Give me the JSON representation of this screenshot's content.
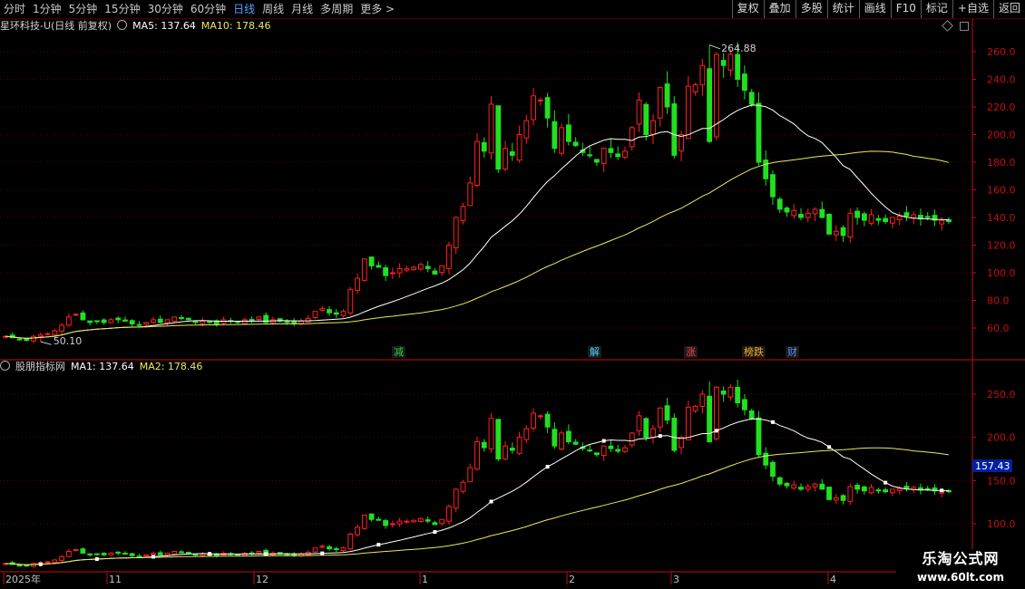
{
  "toolbar": {
    "periods": [
      "分时",
      "1分钟",
      "5分钟",
      "15分钟",
      "30分钟",
      "60分钟",
      "日线",
      "周线",
      "月线",
      "多周期",
      "更多 >"
    ],
    "active_period": "日线",
    "buttons": [
      "复权",
      "叠加",
      "多股",
      "统计",
      "画线",
      "F10",
      "标记",
      "+自选",
      "返回"
    ]
  },
  "main_title": {
    "stock": "星环科技-U(日线 前复权)",
    "ma5": "MA5: 137.64",
    "ma10": "MA10: 178.46"
  },
  "sub_title": {
    "name": "股朋指标网",
    "ma1": "MA1: 137.64",
    "ma2": "MA2: 178.46"
  },
  "annotations": {
    "high": "264.88",
    "low": "50.10",
    "last_value": "157.43"
  },
  "event_tags": [
    {
      "text": "减",
      "color": "#2ecc40"
    },
    {
      "text": "解",
      "color": "#4ad0ff"
    },
    {
      "text": "涨",
      "color": "#ff4040"
    },
    {
      "text": "榜跌",
      "color": "#ffb020"
    },
    {
      "text": "财",
      "color": "#5c8aff"
    }
  ],
  "watermark": {
    "line1": "乐淘公式网",
    "line2": "www.60lt.com"
  },
  "colors": {
    "up": "#ff2020",
    "down": "#20e020",
    "ma_short": "#ffffff",
    "ma_long": "#e8e860",
    "axis": "#c01010",
    "text": "#c0c0c0"
  },
  "chart_data": [
    {
      "type": "candlestick",
      "title": "星环科技-U(日线 前复权)",
      "ylim": [
        50,
        275
      ],
      "y_ticks": [
        60,
        80,
        100,
        120,
        140,
        160,
        180,
        200,
        220,
        240,
        260
      ],
      "x_ticks": [
        "2025年",
        "11",
        "12",
        "1",
        "2",
        "3",
        "4"
      ],
      "price_path": [
        54,
        53,
        52,
        51,
        54,
        55,
        56,
        58,
        62,
        68,
        70,
        66,
        64,
        65,
        64,
        66,
        66,
        65,
        63,
        62,
        64,
        66,
        64,
        66,
        68,
        67,
        66,
        64,
        65,
        64,
        63,
        66,
        65,
        64,
        66,
        65,
        68,
        64,
        66,
        65,
        64,
        63,
        65,
        67,
        72,
        74,
        71,
        70,
        72,
        88,
        96,
        110,
        105,
        104,
        98,
        100,
        103,
        103,
        104,
        106,
        103,
        99,
        105,
        120,
        140,
        148,
        165,
        195,
        188,
        222,
        175,
        190,
        185,
        200,
        210,
        228,
        225,
        212,
        190,
        205,
        195,
        192,
        187,
        185,
        180,
        190,
        187,
        184,
        188,
        205,
        225,
        200,
        210,
        234,
        220,
        185,
        200,
        235,
        236,
        250,
        195,
        258,
        250,
        258,
        240,
        232,
        222,
        180,
        168,
        155,
        146,
        144,
        145,
        140,
        143,
        146,
        140,
        128,
        130,
        127,
        143,
        140,
        138,
        142,
        138,
        137,
        140,
        141,
        141,
        142,
        139,
        140,
        138,
        138,
        137
      ],
      "ma5_end": 137.64,
      "ma10_end": 178.46,
      "high": 264.88,
      "low": 50.1
    },
    {
      "type": "candlestick",
      "title": "股朋指标网",
      "ylim": [
        80,
        275
      ],
      "y_ticks": [
        100,
        150,
        200,
        250
      ],
      "series": [
        {
          "name": "MA1",
          "last": 137.64
        },
        {
          "name": "MA2",
          "last": 178.46
        }
      ],
      "last_value": 157.43
    }
  ]
}
